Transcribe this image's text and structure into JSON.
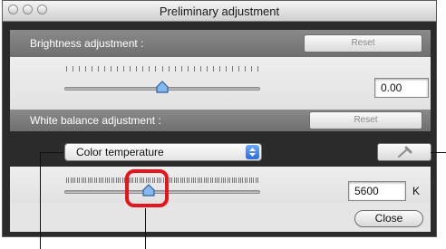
{
  "window": {
    "title": "Preliminary adjustment"
  },
  "brightness": {
    "label": "Brightness adjustment :",
    "reset_label": "Reset",
    "value": "0.00",
    "slider_fraction": 0.5
  },
  "white_balance": {
    "label": "White balance adjustment :",
    "reset_label": "Reset",
    "mode": "Color temperature",
    "value": "5600",
    "unit": "K",
    "slider_fraction": 0.43
  },
  "footer": {
    "close_label": "Close"
  },
  "icons": {
    "eyedropper": "eyedropper-icon",
    "select_arrows": "up-down-arrows-icon",
    "slider_thumb": "slider-thumb"
  },
  "colors": {
    "highlight": "#e8141b",
    "header_band": "#7d7d7d",
    "window_body": "#2b2b2b"
  }
}
